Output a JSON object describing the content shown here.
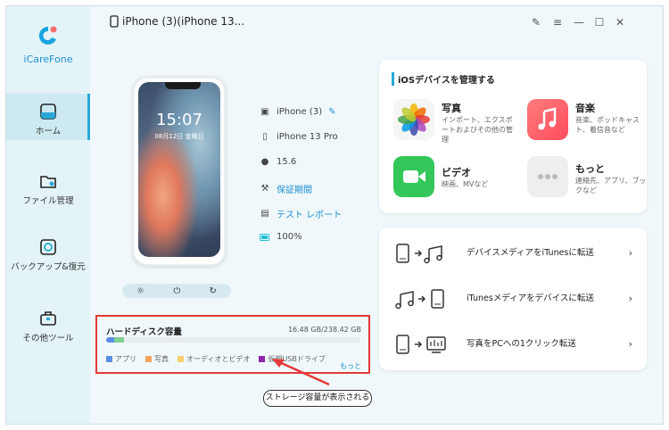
{
  "app": {
    "brand": "iCareFone",
    "device_title": "iPhone (3)(iPhone 13..."
  },
  "nav": [
    {
      "label": "ホーム",
      "active": true
    },
    {
      "label": "ファイル管理",
      "active": false
    },
    {
      "label": "バックアップ&復元",
      "active": false
    },
    {
      "label": "その他ツール",
      "active": false
    }
  ],
  "phone": {
    "time": "15:07",
    "date": "08月12日 金曜日"
  },
  "device_info": {
    "name": "iPhone (3)",
    "model": "iPhone 13 Pro",
    "ios": "15.6",
    "warranty": "保証期間",
    "test_report": "テスト レポート",
    "battery": "100%"
  },
  "manage": {
    "title": "iOSデバイスを管理する",
    "tiles": [
      {
        "title": "写真",
        "desc": "インポート、エクスポートおよびその他の管理",
        "icon": "photos-icon"
      },
      {
        "title": "音楽",
        "desc": "音楽、ポッドキャスト、着信音など",
        "icon": "music-icon"
      },
      {
        "title": "ビデオ",
        "desc": "映画、MVなど",
        "icon": "video-icon"
      },
      {
        "title": "もっと",
        "desc": "連絡先、アプリ、ブックなど",
        "icon": "more-icon"
      }
    ]
  },
  "transfers": [
    {
      "label": "デバイスメディアをiTunesに転送"
    },
    {
      "label": "iTunesメディアをデバイスに転送"
    },
    {
      "label": "写真をPCへの1クリック転送"
    }
  ],
  "disk": {
    "title": "ハードディスク容量",
    "size": "16.48 GB/238.42 GB",
    "used_fraction": 0.069,
    "legend": [
      {
        "label": "アプリ",
        "color": "#5b8ee6"
      },
      {
        "label": "写真",
        "color": "#f4a261"
      },
      {
        "label": "オーディオとビデオ",
        "color": "#f6d06f"
      },
      {
        "label": "仮想USBドライブ",
        "color": "#8e24aa"
      }
    ],
    "more": "もっと"
  },
  "callout": "ストレージ容量が表示される",
  "colors": {
    "accent": "#27a8d6",
    "highlight": "#e53935"
  }
}
